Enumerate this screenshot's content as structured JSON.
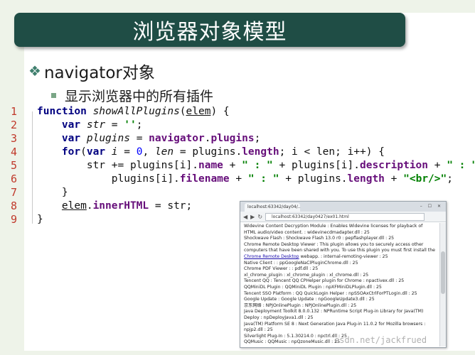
{
  "slide": {
    "title": "浏览器对象模型",
    "bullet1": "navigator对象",
    "bullet2": "显示浏览器中的所有插件"
  },
  "code": {
    "line_numbers": [
      "1",
      "2",
      "3",
      "4",
      "5",
      "6",
      "7",
      "8",
      "9"
    ]
  },
  "browser": {
    "tab_label": "localhost:63342/day04/...",
    "window_buttons": "– ☐ ✕",
    "url": "localhost:63342/day0427/ex01.html",
    "lines": [
      "Widevine Content Decryption Module : Enables Widevine licenses for playback of",
      "HTML audio/video content. : widevinecdmadapter.dll : 25",
      "Shockwave Flash : Shockwave Flash 13.0 r0 : pepflashplayer.dll : 25",
      "Chrome Remote Desktop Viewer : This plugin allows you to securely access other",
      "computers that have been shared with you. To use this plugin you must first install the",
      "webapp. : internal-remoting-viewer : 25",
      "Native Client : : ppGoogleNaClPluginChrome.dll : 25",
      "Chrome PDF Viewer : : pdf.dll : 25",
      "xl_chrome_plugin : xl_chrome_plugin : xl_chrome.dll : 25",
      "Tencent QQ : Tencent QQ CPHelper plugin for Chrome : npactivex.dll : 25",
      "QQMiniDL Plugin : QQMiniDL Plugin : npXFMiniDLPlugin.dll : 25",
      "Tencent SSO Platform : QQ QuickLogin Helper : npSSOAxCtrlForPTLogin.dll : 25",
      "Google Update : Google Update : npGoogleUpdate3.dll : 25",
      "京东网络 : NPJOnlinePlugin : NPJOnlinePlugin.dll : 25",
      "Java Deployment Toolkit 8.0.0.132 : NPRuntime Script Plug-in Library for Java(TM)",
      "Deploy : npDeployJava1.dll : 25",
      "Java(TM) Platform SE 8 : Next Generation Java Plug-in 11.0.2 for Mozilla browsers :",
      "npjp2.dll : 25",
      "Silverlight Plug-In : 5.1.30214.0 : npctrl.dll : 25",
      "QQMusic : QQMusic : npQzoneMusic.dll : 25"
    ],
    "link_text": "Chrome Remote Desktop"
  },
  "watermark": "csdn.net/jackfrued"
}
